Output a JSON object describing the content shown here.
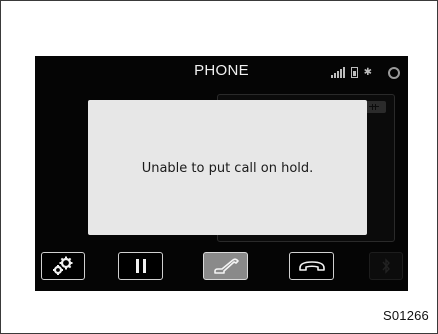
{
  "screen": {
    "title": "PHONE",
    "status_icons": [
      "signal-strength-icon",
      "battery-icon",
      "bluetooth-icon",
      "settings-icon"
    ]
  },
  "dialog": {
    "message": "Unable to put call on hold."
  },
  "buttons": [
    {
      "name": "settings-button",
      "icon": "gears-icon",
      "state": "normal"
    },
    {
      "name": "hold-button",
      "icon": "pause-icon",
      "state": "normal"
    },
    {
      "name": "hands-free-button",
      "icon": "handset-icon",
      "state": "active"
    },
    {
      "name": "end-call-button",
      "icon": "end-call-icon",
      "state": "normal"
    },
    {
      "name": "bluetooth-button",
      "icon": "bluetooth-icon",
      "state": "disabled"
    }
  ],
  "figure_id": "S01266",
  "colors": {
    "screen_bg": "#050505",
    "dialog_bg": "#e7e7e7",
    "active_button": "#8a8a8a"
  }
}
